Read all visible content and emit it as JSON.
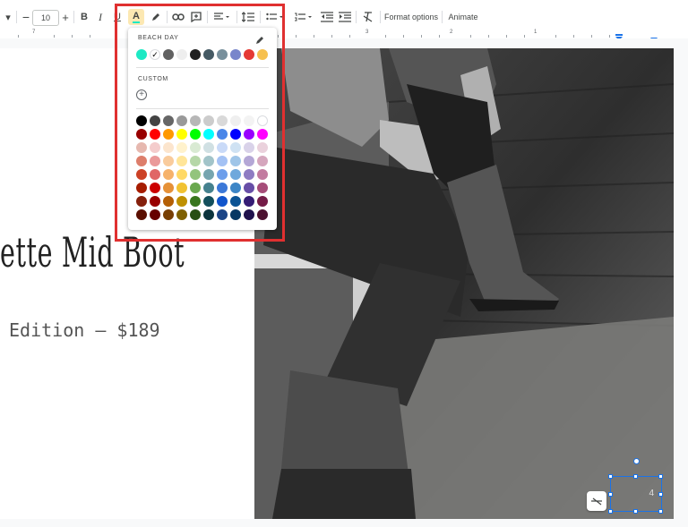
{
  "toolbar": {
    "font_size": "10",
    "format_options": "Format options",
    "animate": "Animate"
  },
  "ruler": {
    "numbers": [
      "7",
      "3",
      "2",
      "1"
    ]
  },
  "palette": {
    "section_beach": "BEACH DAY",
    "section_custom": "CUSTOM",
    "theme_colors": [
      "#1de9c4",
      "#ffffff",
      "#616161",
      "#eeeeee",
      "#212121",
      "#455a64",
      "#78909c",
      "#7986cb",
      "#e53935",
      "#f6c04f"
    ],
    "grid_colors": [
      [
        "#000000",
        "#434343",
        "#666666",
        "#999999",
        "#b7b7b7",
        "#cccccc",
        "#d9d9d9",
        "#efefef",
        "#f3f3f3",
        "#ffffff"
      ],
      [
        "#980000",
        "#ff0000",
        "#ff9900",
        "#ffff00",
        "#00ff00",
        "#00ffff",
        "#4a86e8",
        "#0000ff",
        "#9900ff",
        "#ff00ff"
      ],
      [
        "#e6b8af",
        "#f4cccc",
        "#fce5cd",
        "#fff2cc",
        "#d9ead3",
        "#d0e0e3",
        "#c9daf8",
        "#cfe2f3",
        "#d9d2e9",
        "#ead1dc"
      ],
      [
        "#dd7e6b",
        "#ea9999",
        "#f9cb9c",
        "#ffe599",
        "#b6d7a8",
        "#a2c4c9",
        "#a4c2f4",
        "#9fc5e8",
        "#b4a7d6",
        "#d5a6bd"
      ],
      [
        "#cc4125",
        "#e06666",
        "#f6b26b",
        "#ffd966",
        "#93c47d",
        "#76a5af",
        "#6d9eeb",
        "#6fa8dc",
        "#8e7cc3",
        "#c27ba0"
      ],
      [
        "#a61c00",
        "#cc0000",
        "#e69138",
        "#f1c232",
        "#6aa84f",
        "#45818e",
        "#3c78d8",
        "#3d85c6",
        "#674ea7",
        "#a64d79"
      ],
      [
        "#85200c",
        "#990000",
        "#b45f06",
        "#bf9000",
        "#38761d",
        "#134f5c",
        "#1155cc",
        "#0b5394",
        "#351c75",
        "#741b47"
      ],
      [
        "#5b0f00",
        "#660000",
        "#783f04",
        "#7f6000",
        "#274e13",
        "#0c343d",
        "#1c4587",
        "#073763",
        "#20124d",
        "#4c1130"
      ]
    ]
  },
  "slide": {
    "title": "ette Mid Boot",
    "subtitle": "Edition – $189",
    "page_number": "4"
  }
}
